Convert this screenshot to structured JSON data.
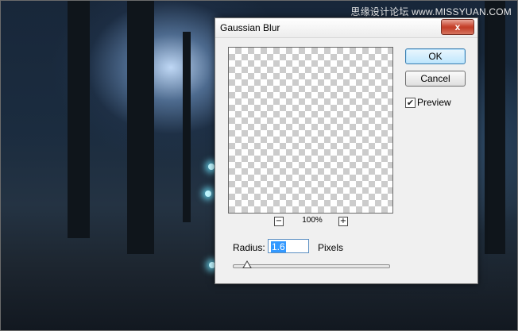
{
  "watermark": "思缘设计论坛 www.MISSYUAN.COM",
  "dialog": {
    "title": "Gaussian Blur",
    "close_label": "x",
    "zoom_out_label": "−",
    "zoom_level": "100%",
    "zoom_in_label": "+",
    "ok_label": "OK",
    "cancel_label": "Cancel",
    "preview_label": "Preview",
    "preview_checked": true,
    "radius_label": "Radius:",
    "radius_value": "1.6",
    "radius_unit": "Pixels",
    "slider_fraction": 0.09
  }
}
